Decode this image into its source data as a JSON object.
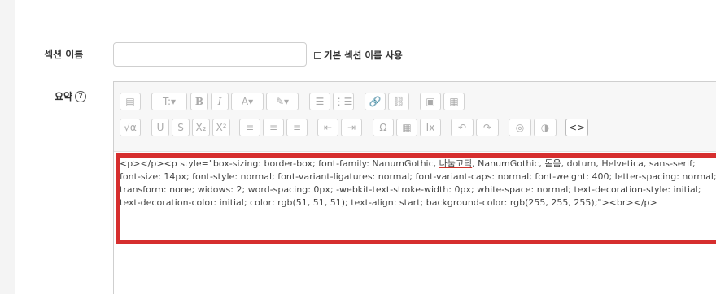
{
  "form": {
    "name_label": "섹션 이름",
    "name_value": "",
    "default_checkbox_label": "기본 섹션 이름 사용",
    "summary_label": "요약",
    "help_icon": "?"
  },
  "toolbar": {
    "row1": [
      {
        "name": "block-icon",
        "glyph": "▤"
      },
      {
        "name": "paragraph-style-icon",
        "glyph": "T:▾"
      },
      {
        "name": "bold-icon",
        "glyph": "B"
      },
      {
        "name": "italic-icon",
        "glyph": "I"
      },
      {
        "name": "font-color-icon",
        "glyph": "A▾"
      },
      {
        "name": "highlight-color-icon",
        "glyph": "✎▾"
      },
      {
        "name": "bullet-list-icon",
        "glyph": "☰"
      },
      {
        "name": "numbered-list-icon",
        "glyph": "⋮☰"
      },
      {
        "name": "link-icon",
        "glyph": "🔗"
      },
      {
        "name": "unlink-icon",
        "glyph": "⛓"
      },
      {
        "name": "image-icon",
        "glyph": "▣"
      },
      {
        "name": "media-icon",
        "glyph": "▦"
      }
    ],
    "row2": [
      {
        "name": "equation-icon",
        "glyph": "√α"
      },
      {
        "name": "underline-icon",
        "glyph": "U"
      },
      {
        "name": "strikethrough-icon",
        "glyph": "S"
      },
      {
        "name": "subscript-icon",
        "glyph": "X₂"
      },
      {
        "name": "superscript-icon",
        "glyph": "X²"
      },
      {
        "name": "align-left-icon",
        "glyph": "≡"
      },
      {
        "name": "align-center-icon",
        "glyph": "≡"
      },
      {
        "name": "align-right-icon",
        "glyph": "≡"
      },
      {
        "name": "outdent-icon",
        "glyph": "⇤"
      },
      {
        "name": "indent-icon",
        "glyph": "⇥"
      },
      {
        "name": "special-char-icon",
        "glyph": "Ω"
      },
      {
        "name": "table-icon",
        "glyph": "▦"
      },
      {
        "name": "clear-format-icon",
        "glyph": "Ix"
      },
      {
        "name": "undo-icon",
        "glyph": "↶"
      },
      {
        "name": "redo-icon",
        "glyph": "↷"
      },
      {
        "name": "accessibility-check-icon",
        "glyph": "◎"
      },
      {
        "name": "screenreader-icon",
        "glyph": "◑"
      },
      {
        "name": "html-source-icon",
        "glyph": "<>"
      }
    ]
  },
  "editor": {
    "line1_start": "<p></p><p style=\"box-sizing: border-box; font-family: NanumGothic, ",
    "line1_underlined": "나눔고딕",
    "line1_end": ", NanumGothic, 돋움, dotum, Helvetica, sans-serif;",
    "line2": "font-size: 14px; font-style: normal; font-variant-ligatures: normal; font-variant-caps: normal; font-weight: 400; letter-spacing: normal;",
    "line3": "transform: none; widows: 2; word-spacing: 0px; -webkit-text-stroke-width: 0px; white-space: normal; text-decoration-style: initial;",
    "line4": "text-decoration-color: initial; color: rgb(51, 51, 51); text-align: start; background-color: rgb(255, 255, 255);\"><br></p>"
  },
  "colors": {
    "highlight_border": "#d62e2e",
    "page_bg": "#ffffff",
    "toolbar_bg": "#f7f7f7"
  }
}
